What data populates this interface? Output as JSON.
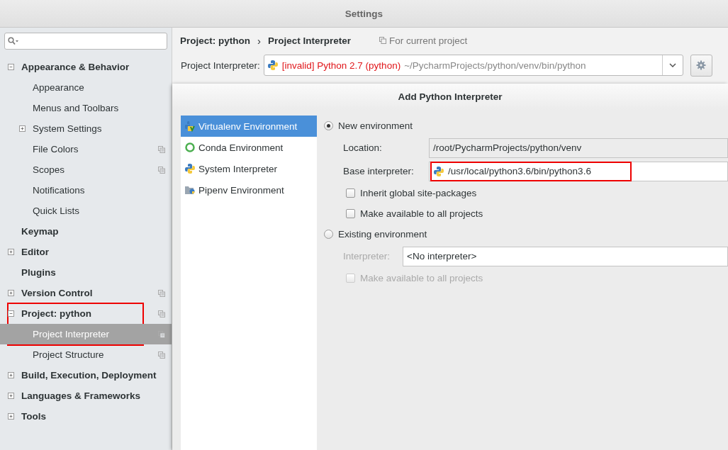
{
  "window": {
    "title": "Settings"
  },
  "sidebar": {
    "tree": [
      {
        "label": "Appearance & Behavior",
        "expanded": true,
        "selected": false,
        "shared": false,
        "highlighted": false,
        "children": [
          {
            "label": "Appearance",
            "selected": false,
            "shared": false,
            "highlighted": false
          },
          {
            "label": "Menus and Toolbars",
            "selected": false,
            "shared": false,
            "highlighted": false
          },
          {
            "label": "System Settings",
            "expanded": false,
            "selected": false,
            "shared": false,
            "highlighted": false
          },
          {
            "label": "File Colors",
            "selected": false,
            "shared": true,
            "highlighted": false
          },
          {
            "label": "Scopes",
            "selected": false,
            "shared": true,
            "highlighted": false
          },
          {
            "label": "Notifications",
            "selected": false,
            "shared": false,
            "highlighted": false
          },
          {
            "label": "Quick Lists",
            "selected": false,
            "shared": false,
            "highlighted": false
          }
        ]
      },
      {
        "label": "Keymap",
        "selected": false,
        "shared": false,
        "highlighted": false
      },
      {
        "label": "Editor",
        "expanded": false,
        "selected": false,
        "shared": false,
        "highlighted": false
      },
      {
        "label": "Plugins",
        "selected": false,
        "shared": false,
        "highlighted": false
      },
      {
        "label": "Version Control",
        "expanded": false,
        "selected": false,
        "shared": true,
        "highlighted": false
      },
      {
        "label": "Project: python",
        "expanded": true,
        "selected": false,
        "shared": true,
        "highlighted": true,
        "children": [
          {
            "label": "Project Interpreter",
            "selected": true,
            "shared": true,
            "highlighted": true
          },
          {
            "label": "Project Structure",
            "selected": false,
            "shared": true,
            "highlighted": false
          }
        ]
      },
      {
        "label": "Build, Execution, Deployment",
        "expanded": false,
        "selected": false,
        "shared": false,
        "highlighted": false
      },
      {
        "label": "Languages & Frameworks",
        "expanded": false,
        "selected": false,
        "shared": false,
        "highlighted": false
      },
      {
        "label": "Tools",
        "expanded": false,
        "selected": false,
        "shared": false,
        "highlighted": false
      }
    ]
  },
  "breadcrumb": {
    "items": [
      "Project: python",
      "Project Interpreter"
    ],
    "separator": "›",
    "scope_note": "For current project"
  },
  "interpreter": {
    "label": "Project Interpreter:",
    "status": "[invalid] Python 2.7 (python)",
    "path": "~/PycharmProjects/python/venv/bin/python"
  },
  "dialog": {
    "title": "Add Python Interpreter",
    "environments": [
      {
        "kind": "virtualenv",
        "label": "Virtualenv Environment",
        "selected": true
      },
      {
        "kind": "conda",
        "label": "Conda Environment",
        "selected": false
      },
      {
        "kind": "system",
        "label": "System Interpreter",
        "selected": false
      },
      {
        "kind": "pipenv",
        "label": "Pipenv Environment",
        "selected": false
      }
    ],
    "new_environment": {
      "label": "New environment",
      "selected": true,
      "location_label": "Location:",
      "location": "/root/PycharmProjects/python/venv",
      "base_label": "Base interpreter:",
      "base_value": "/usr/local/python3.6/bin/python3.6",
      "base_highlighted": true,
      "checkboxes": [
        {
          "label": "Inherit global site-packages",
          "checked": false,
          "disabled": false
        },
        {
          "label": "Make available to all projects",
          "checked": false,
          "disabled": false
        }
      ]
    },
    "existing_environment": {
      "label": "Existing environment",
      "selected": false,
      "interpreter_label": "Interpreter:",
      "interpreter_value": "<No interpreter>",
      "disabled": true,
      "checkboxes": [
        {
          "label": "Make available to all projects",
          "checked": false,
          "disabled": true
        }
      ]
    }
  }
}
